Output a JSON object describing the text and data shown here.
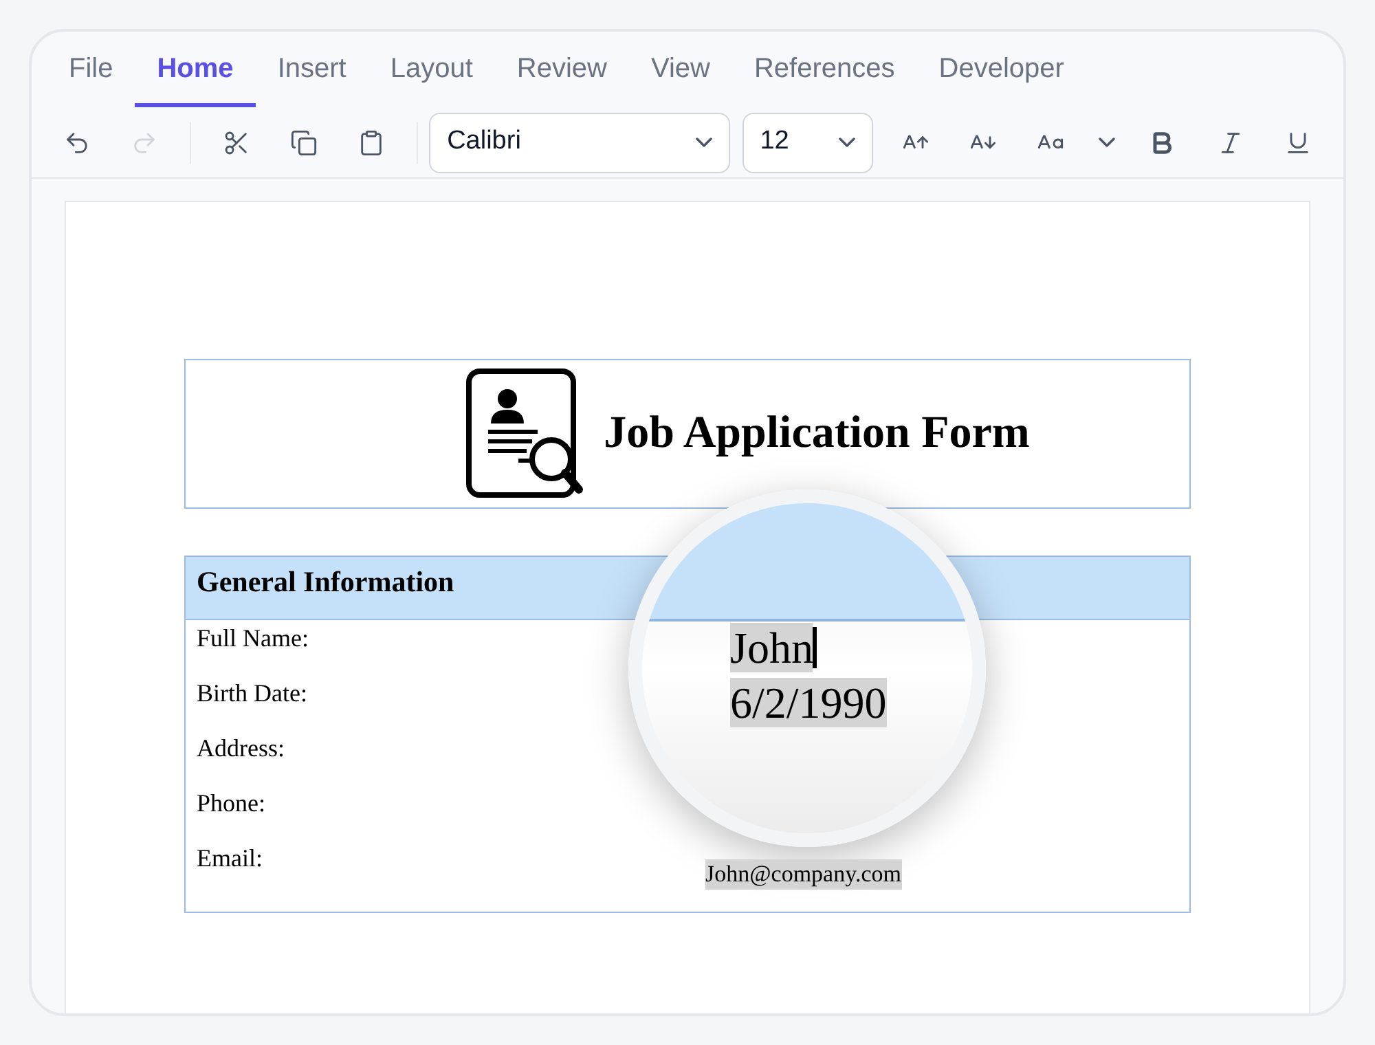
{
  "menu_tabs": [
    {
      "label": "File",
      "selected": false
    },
    {
      "label": "Home",
      "selected": true
    },
    {
      "label": "Insert",
      "selected": false
    },
    {
      "label": "Layout",
      "selected": false
    },
    {
      "label": "Review",
      "selected": false
    },
    {
      "label": "View",
      "selected": false
    },
    {
      "label": "References",
      "selected": false
    },
    {
      "label": "Developer",
      "selected": false
    }
  ],
  "toolbar": {
    "history": [
      {
        "kind": "undo",
        "disabled": false
      },
      {
        "kind": "redo",
        "disabled": true
      }
    ],
    "clipboard": [
      {
        "kind": "cut"
      },
      {
        "kind": "copy"
      },
      {
        "kind": "paste"
      }
    ],
    "font": {
      "value": "Calibri"
    },
    "size": {
      "value": "12"
    },
    "format": [
      {
        "kind": "grow"
      },
      {
        "kind": "shrink"
      },
      {
        "kind": "case"
      },
      {
        "kind": "case-menu"
      },
      {
        "kind": "bold"
      },
      {
        "kind": "italic"
      },
      {
        "kind": "underline"
      }
    ]
  },
  "document": {
    "title": "Job Application Form",
    "section": "General Information",
    "fields": [
      {
        "label": "Full Name:",
        "value": "John",
        "magnified": true,
        "cursor": true
      },
      {
        "label": "Birth Date:",
        "value": "6/2/1990",
        "magnified": true
      },
      {
        "label": "Address:"
      },
      {
        "label": "Phone:"
      },
      {
        "label": "Email:",
        "value": "John@company.com",
        "magnified": false
      }
    ]
  }
}
